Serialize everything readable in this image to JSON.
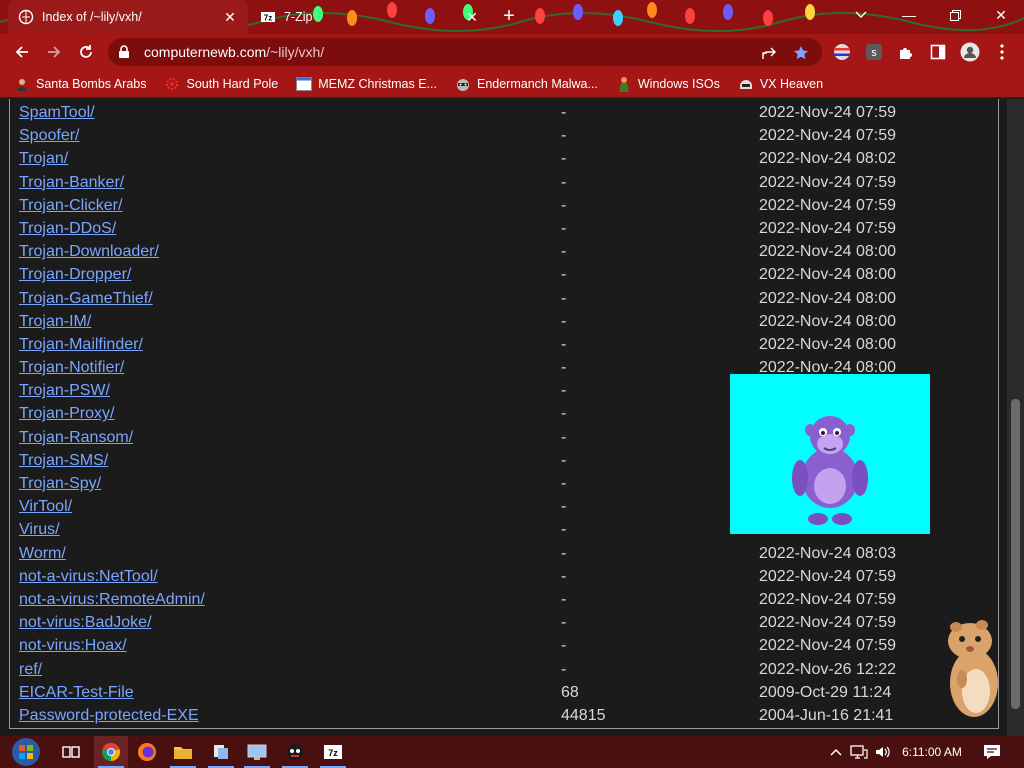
{
  "browser": {
    "tabs": [
      {
        "title": "Index of /~lily/vxh/",
        "active": true,
        "favicon": "web-icon"
      },
      {
        "title": "7-Zip",
        "active": false,
        "favicon": "7zip-icon"
      }
    ],
    "url": {
      "host": "computernewb.com",
      "path": "/~lily/vxh/"
    },
    "bookmarks": [
      {
        "label": "Santa Bombs Arabs",
        "icon": "user-icon"
      },
      {
        "label": "South Hard Pole",
        "icon": "flower-icon"
      },
      {
        "label": "MEMZ Christmas E...",
        "icon": "window-icon"
      },
      {
        "label": "Endermanch Malwa...",
        "icon": "raccoon-icon"
      },
      {
        "label": "Windows ISOs",
        "icon": "figure-icon"
      },
      {
        "label": "VX Heaven",
        "icon": "helmet-icon"
      }
    ]
  },
  "listing": {
    "rows": [
      {
        "name": "SpamTool/",
        "size": "-",
        "date": "2022-Nov-24 07:59"
      },
      {
        "name": "Spoofer/",
        "size": "-",
        "date": "2022-Nov-24 07:59"
      },
      {
        "name": "Trojan/",
        "size": "-",
        "date": "2022-Nov-24 08:02"
      },
      {
        "name": "Trojan-Banker/",
        "size": "-",
        "date": "2022-Nov-24 07:59"
      },
      {
        "name": "Trojan-Clicker/",
        "size": "-",
        "date": "2022-Nov-24 07:59"
      },
      {
        "name": "Trojan-DDoS/",
        "size": "-",
        "date": "2022-Nov-24 07:59"
      },
      {
        "name": "Trojan-Downloader/",
        "size": "-",
        "date": "2022-Nov-24 08:00"
      },
      {
        "name": "Trojan-Dropper/",
        "size": "-",
        "date": "2022-Nov-24 08:00"
      },
      {
        "name": "Trojan-GameThief/",
        "size": "-",
        "date": "2022-Nov-24 08:00"
      },
      {
        "name": "Trojan-IM/",
        "size": "-",
        "date": "2022-Nov-24 08:00"
      },
      {
        "name": "Trojan-Mailfinder/",
        "size": "-",
        "date": "2022-Nov-24 08:00"
      },
      {
        "name": "Trojan-Notifier/",
        "size": "-",
        "date": "2022-Nov-24 08:00"
      },
      {
        "name": "Trojan-PSW/",
        "size": "-",
        "date": ""
      },
      {
        "name": "Trojan-Proxy/",
        "size": "-",
        "date": ""
      },
      {
        "name": "Trojan-Ransom/",
        "size": "-",
        "date": ""
      },
      {
        "name": "Trojan-SMS/",
        "size": "-",
        "date": ""
      },
      {
        "name": "Trojan-Spy/",
        "size": "-",
        "date": ""
      },
      {
        "name": "VirTool/",
        "size": "-",
        "date": ""
      },
      {
        "name": "Virus/",
        "size": "-",
        "date": ""
      },
      {
        "name": "Worm/",
        "size": "-",
        "date": "2022-Nov-24 08:03"
      },
      {
        "name": "not-a-virus:NetTool/",
        "size": "-",
        "date": "2022-Nov-24 07:59"
      },
      {
        "name": "not-a-virus:RemoteAdmin/",
        "size": "-",
        "date": "2022-Nov-24 07:59"
      },
      {
        "name": "not-virus:BadJoke/",
        "size": "-",
        "date": "2022-Nov-24 07:59"
      },
      {
        "name": "not-virus:Hoax/",
        "size": "-",
        "date": "2022-Nov-24 07:59"
      },
      {
        "name": "ref/",
        "size": "-",
        "date": "2022-Nov-26 12:22"
      },
      {
        "name": "EICAR-Test-File",
        "size": "68",
        "date": "2009-Oct-29 11:24"
      },
      {
        "name": "Password-protected-EXE",
        "size": "44815",
        "date": "2004-Jun-16 21:41"
      }
    ]
  },
  "taskbar": {
    "clock": "6:11:00 AM",
    "pinned": [
      "start-orb-icon",
      "task-view-icon",
      "chrome-icon",
      "firefox-icon",
      "file-explorer-icon",
      "app-icon",
      "control-panel-icon",
      "bonzi-icon",
      "7zip-icon"
    ]
  },
  "colors": {
    "chrome_red": "#a51616",
    "tabstrip_red": "#8f1010",
    "link_blue": "#7aa6ff",
    "popup_cyan": "#00ffff",
    "page_bg": "#1b1b1b"
  }
}
